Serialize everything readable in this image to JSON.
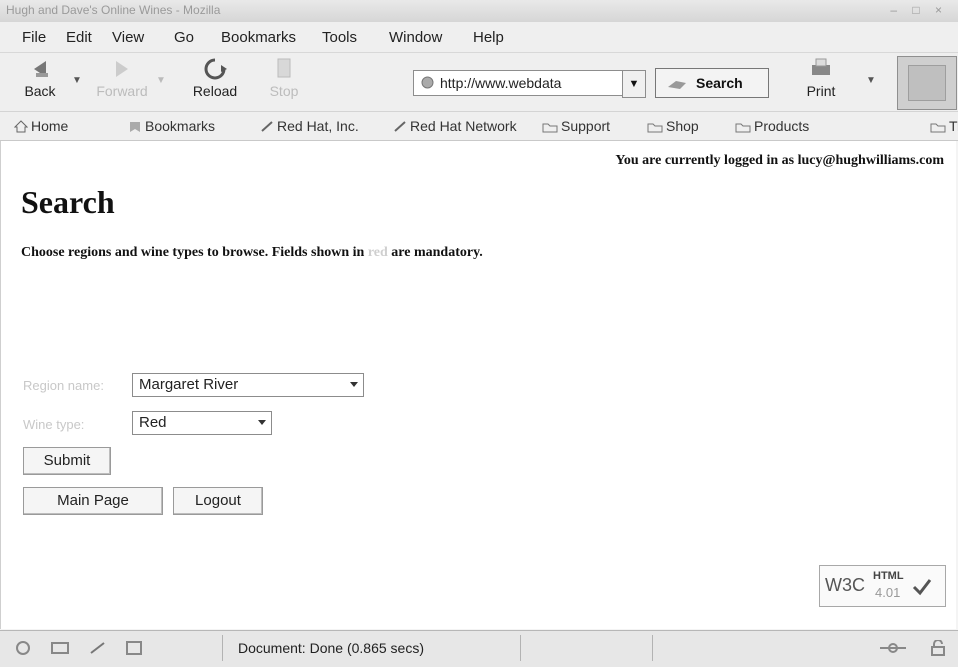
{
  "window": {
    "title": "Hugh and Dave's Online Wines - Mozilla"
  },
  "menu": [
    "File",
    "Edit",
    "View",
    "Go",
    "Bookmarks",
    "Tools",
    "Window",
    "Help"
  ],
  "toolbar": {
    "back": "Back",
    "forward": "Forward",
    "reload": "Reload",
    "stop": "Stop",
    "url": "http://www.webdata",
    "search": "Search",
    "print": "Print"
  },
  "bookmarks": [
    "Home",
    "Bookmarks",
    "Red Hat, Inc.",
    "Red Hat Network",
    "Support",
    "Shop",
    "Products",
    "Tr"
  ],
  "page": {
    "logged_in": "You are currently logged in as lucy@hughwilliams.com",
    "heading": "Search",
    "instructions_pre": "Choose regions and wine types to browse. Fields shown in",
    "instructions_red": "red",
    "instructions_post": "are mandatory.",
    "region_label": "Region name:",
    "region_value": "Margaret River",
    "winetype_label": "Wine type:",
    "winetype_value": "Red",
    "submit": "Submit",
    "main_page": "Main Page",
    "logout": "Logout",
    "w3c_logo": "W3C",
    "w3c_html": "HTML",
    "w3c_version": "4.01"
  },
  "status": {
    "text": "Document: Done (0.865 secs)"
  }
}
